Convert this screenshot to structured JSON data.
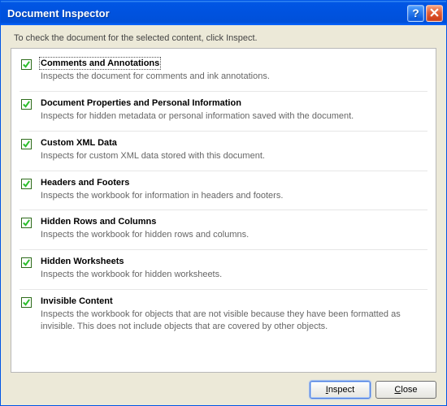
{
  "window": {
    "title": "Document Inspector"
  },
  "instruction": "To check the document for the selected content, click Inspect.",
  "items": [
    {
      "title": "Comments and Annotations",
      "desc": "Inspects the document for comments and ink annotations.",
      "checked": true,
      "focused": true
    },
    {
      "title": "Document Properties and Personal Information",
      "desc": "Inspects for hidden metadata or personal information saved with the document.",
      "checked": true,
      "focused": false
    },
    {
      "title": "Custom XML Data",
      "desc": "Inspects for custom XML data stored with this document.",
      "checked": true,
      "focused": false
    },
    {
      "title": "Headers and Footers",
      "desc": "Inspects the workbook for information in headers and footers.",
      "checked": true,
      "focused": false
    },
    {
      "title": "Hidden Rows and Columns",
      "desc": "Inspects the workbook for hidden rows and columns.",
      "checked": true,
      "focused": false
    },
    {
      "title": "Hidden Worksheets",
      "desc": "Inspects the workbook for hidden worksheets.",
      "checked": true,
      "focused": false
    },
    {
      "title": "Invisible Content",
      "desc": "Inspects the workbook for objects that are not visible because they have been formatted as invisible. This does not include objects that are covered by other objects.",
      "checked": true,
      "focused": false
    }
  ],
  "buttons": {
    "inspect": "Inspect",
    "close": "Close",
    "inspect_accel": "I",
    "close_accel": "C"
  }
}
